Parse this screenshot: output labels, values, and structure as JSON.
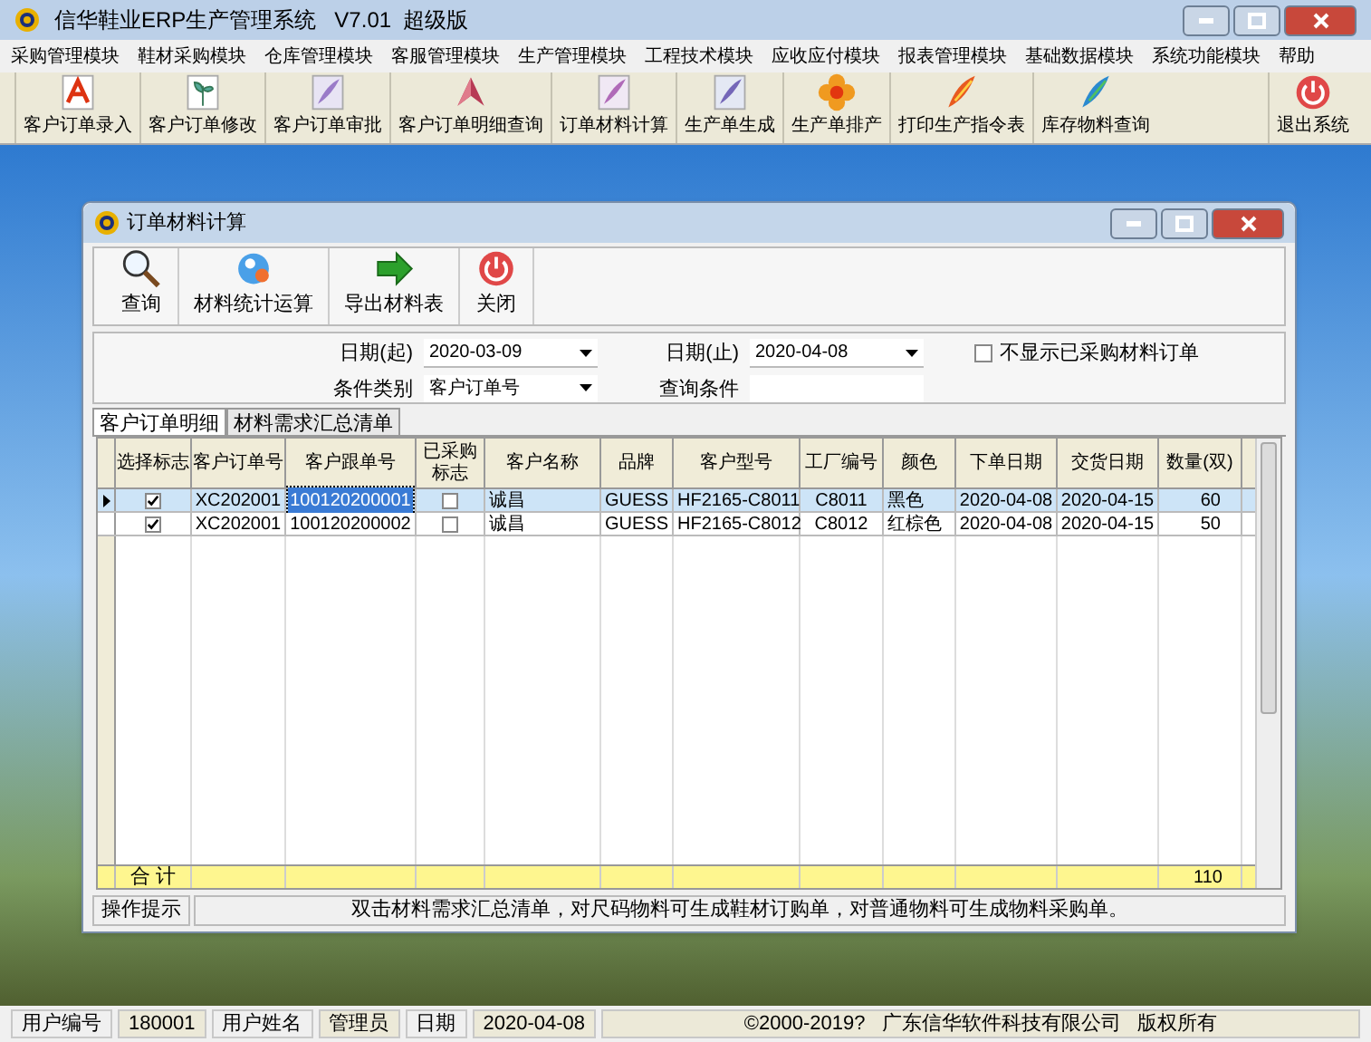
{
  "window": {
    "title": "信华鞋业ERP生产管理系统   V7.01  超级版"
  },
  "menu": [
    "采购管理模块",
    "鞋材采购模块",
    "仓库管理模块",
    "客服管理模块",
    "生产管理模块",
    "工程技术模块",
    "应收应付模块",
    "报表管理模块",
    "基础数据模块",
    "系统功能模块",
    "帮助"
  ],
  "toolbar": [
    "客户订单录入",
    "客户订单修改",
    "客户订单审批",
    "客户订单明细查询",
    "订单材料计算",
    "生产单生成",
    "生产单排产",
    "打印生产指令表",
    "库存物料查询",
    "退出系统"
  ],
  "child_window": {
    "title": "订单材料计算",
    "toolbar": [
      "查询",
      "材料统计运算",
      "导出材料表",
      "关闭"
    ],
    "filters": {
      "date_from_label": "日期(起)",
      "date_from": "2020-03-09",
      "date_to_label": "日期(止)",
      "date_to": "2020-04-08",
      "hide_purchased": {
        "label": "不显示已采购材料订单",
        "checked": false
      },
      "condition_type_label": "条件类别",
      "condition_type": "客户订单号",
      "query_label": "查询条件"
    },
    "tabs": [
      {
        "label": "客户订单明细",
        "selected": true
      },
      {
        "label": "材料需求汇总清单",
        "selected": false
      }
    ],
    "table": {
      "columns": [
        "选择标志",
        "客户订单号",
        "客户跟单号",
        "已采购标志",
        "客户名称",
        "品牌",
        "客户型号",
        "工厂编号",
        "颜色",
        "下单日期",
        "交货日期",
        "数量(双)"
      ],
      "rows": [
        {
          "selected": true,
          "cells": [
            {
              "checked": true
            },
            "XC202001",
            "100120200001",
            {
              "checked": false
            },
            "诚昌",
            "GUESS",
            "HF2165-C8011",
            "C8011",
            "黑色",
            "2020-04-08",
            "2020-04-15",
            "60"
          ]
        },
        {
          "selected": false,
          "cells": [
            {
              "checked": true
            },
            "XC202001",
            "100120200002",
            {
              "checked": false
            },
            "诚昌",
            "GUESS",
            "HF2165-C8012",
            "C8012",
            "红棕色",
            "2020-04-08",
            "2020-04-15",
            "50"
          ]
        }
      ],
      "total_label": "合 计",
      "total_quantity": "110"
    },
    "hint_label": "操作提示",
    "hint": "双击材料需求汇总清单，对尺码物料可生成鞋材订购单，对普通物料可生成物料采购单。"
  },
  "status_bar": [
    "用户编号",
    "180001",
    "用户姓名",
    "管理员",
    "日期",
    "2020-04-08"
  ],
  "copyright": "©2000-2019?   广东信华软件科技有限公司   版权所有"
}
